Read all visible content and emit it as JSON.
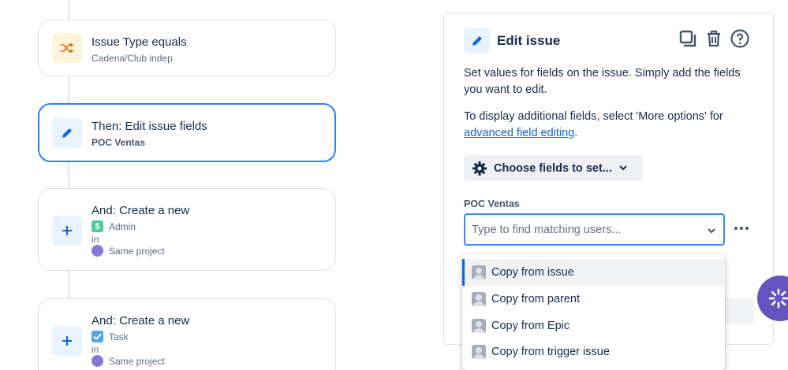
{
  "rules": [
    {
      "title": "Issue Type equals",
      "subtitle": "Cadena/Club indep",
      "icon": "shuffle-icon"
    },
    {
      "title": "Then: Edit issue fields",
      "subtitle": "POC Ventas",
      "icon": "pencil-icon"
    },
    {
      "title": "And: Create a new",
      "type_label": "Admin",
      "in_label": "in",
      "project_label": "Same project",
      "icon": "plus-icon"
    },
    {
      "title": "And: Create a new",
      "type_label": "Task",
      "in_label": "in",
      "project_label": "Same project",
      "icon": "plus-icon"
    }
  ],
  "panel": {
    "title": "Edit issue",
    "description": "Set values for fields on the issue. Simply add the fields you want to edit.",
    "more_text": "To display additional fields, select 'More options' for",
    "link_text": "advanced field editing",
    "period": ".",
    "choose_label": "Choose fields to set...",
    "field_label": "POC Ventas",
    "input_placeholder": "Type to find matching users..."
  },
  "dropdown": {
    "options": [
      "Copy from issue",
      "Copy from parent",
      "Copy from Epic",
      "Copy from trigger issue"
    ],
    "selected_index": 0
  },
  "icons": {
    "header": [
      "duplicate-icon",
      "trash-icon",
      "help-icon"
    ],
    "fab": "spinner-icon"
  },
  "colors": {
    "accent": "#0c66e4",
    "selected_border": "#2684ff",
    "fab": "#6554c0"
  }
}
